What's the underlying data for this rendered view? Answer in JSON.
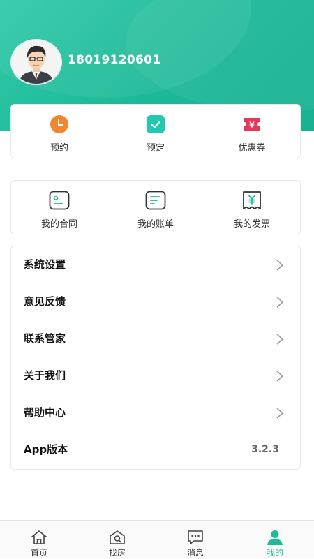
{
  "profile": {
    "phone": "18019120601"
  },
  "quick_actions": [
    {
      "label": "预约",
      "icon": "clock-icon",
      "color": "#f0872f"
    },
    {
      "label": "预定",
      "icon": "check-icon",
      "color": "#22c9b1"
    },
    {
      "label": "优惠券",
      "icon": "coupon-icon",
      "color": "#e8365a"
    }
  ],
  "services": [
    {
      "label": "我的合同",
      "icon": "contract-icon"
    },
    {
      "label": "我的账单",
      "icon": "bill-icon"
    },
    {
      "label": "我的发票",
      "icon": "invoice-icon"
    }
  ],
  "menu": [
    {
      "label": "系统设置"
    },
    {
      "label": "意见反馈"
    },
    {
      "label": "联系管家"
    },
    {
      "label": "关于我们"
    },
    {
      "label": "帮助中心"
    },
    {
      "label": "App版本",
      "value": "3.2.3"
    }
  ],
  "tabbar": [
    {
      "label": "首页",
      "icon": "home-icon"
    },
    {
      "label": "找房",
      "icon": "house-search-icon"
    },
    {
      "label": "消息",
      "icon": "message-icon"
    },
    {
      "label": "我的",
      "icon": "user-icon",
      "active": true
    }
  ],
  "colors": {
    "accent": "#1bbc97",
    "header": "#1db997",
    "icon_dark": "#333333",
    "icon_teal": "#1bbc97"
  }
}
